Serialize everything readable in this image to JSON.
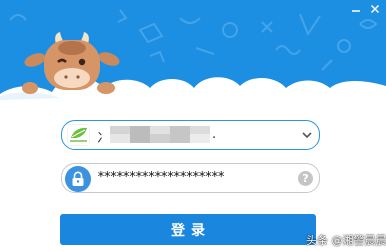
{
  "window": {
    "minimize_icon": "minimize-icon",
    "close_icon": "close-icon"
  },
  "header": {
    "background_color": "#1c8fe3",
    "mascot_icon": "cow-mascot"
  },
  "login_form": {
    "account": {
      "value_prefix": "冫",
      "value_suffix": ".",
      "logo_icon": "sns-leaf-logo",
      "dropdown_icon": "chevron-down-icon"
    },
    "password": {
      "value": "********************",
      "lock_icon": "lock-icon",
      "help_label": "?"
    },
    "login_button": {
      "label": "登录",
      "color": "#1b86de"
    }
  },
  "watermark": {
    "text": "头条 @湘警晨晨"
  }
}
